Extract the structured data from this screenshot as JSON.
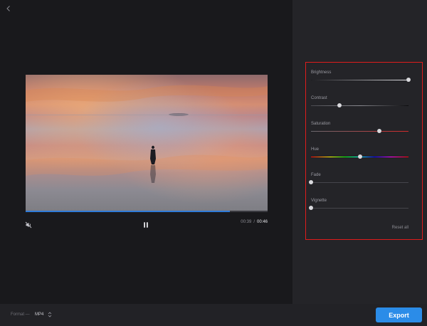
{
  "player": {
    "current_time": "00:39",
    "separator": "/",
    "duration": "00:46",
    "progress": 0.845,
    "muted": true,
    "playing": true
  },
  "adjustments": {
    "items": [
      {
        "label": "Brightness",
        "value": 1.0,
        "gradient": "brightness"
      },
      {
        "label": "Contrast",
        "value": 0.29,
        "gradient": "contrast"
      },
      {
        "label": "Saturation",
        "value": 0.7,
        "gradient": "saturation"
      },
      {
        "label": "Hue",
        "value": 0.5,
        "gradient": "hue"
      },
      {
        "label": "Fade",
        "value": 0.0,
        "gradient": "plain"
      },
      {
        "label": "Vignette",
        "value": 0.0,
        "gradient": "plain"
      }
    ],
    "reset_label": "Reset all"
  },
  "footer": {
    "format_label": "Format —",
    "format_value": "MP4",
    "format_icon": "chevron-updown-icon",
    "export_label": "Export"
  },
  "colors": {
    "accent": "#2b8ce8",
    "progress": "#2f7bd8",
    "highlight_border": "#e01c1c"
  },
  "icons": {
    "back": "chevron-left-icon",
    "mute": "speaker-muted-icon",
    "pause": "pause-icon"
  }
}
